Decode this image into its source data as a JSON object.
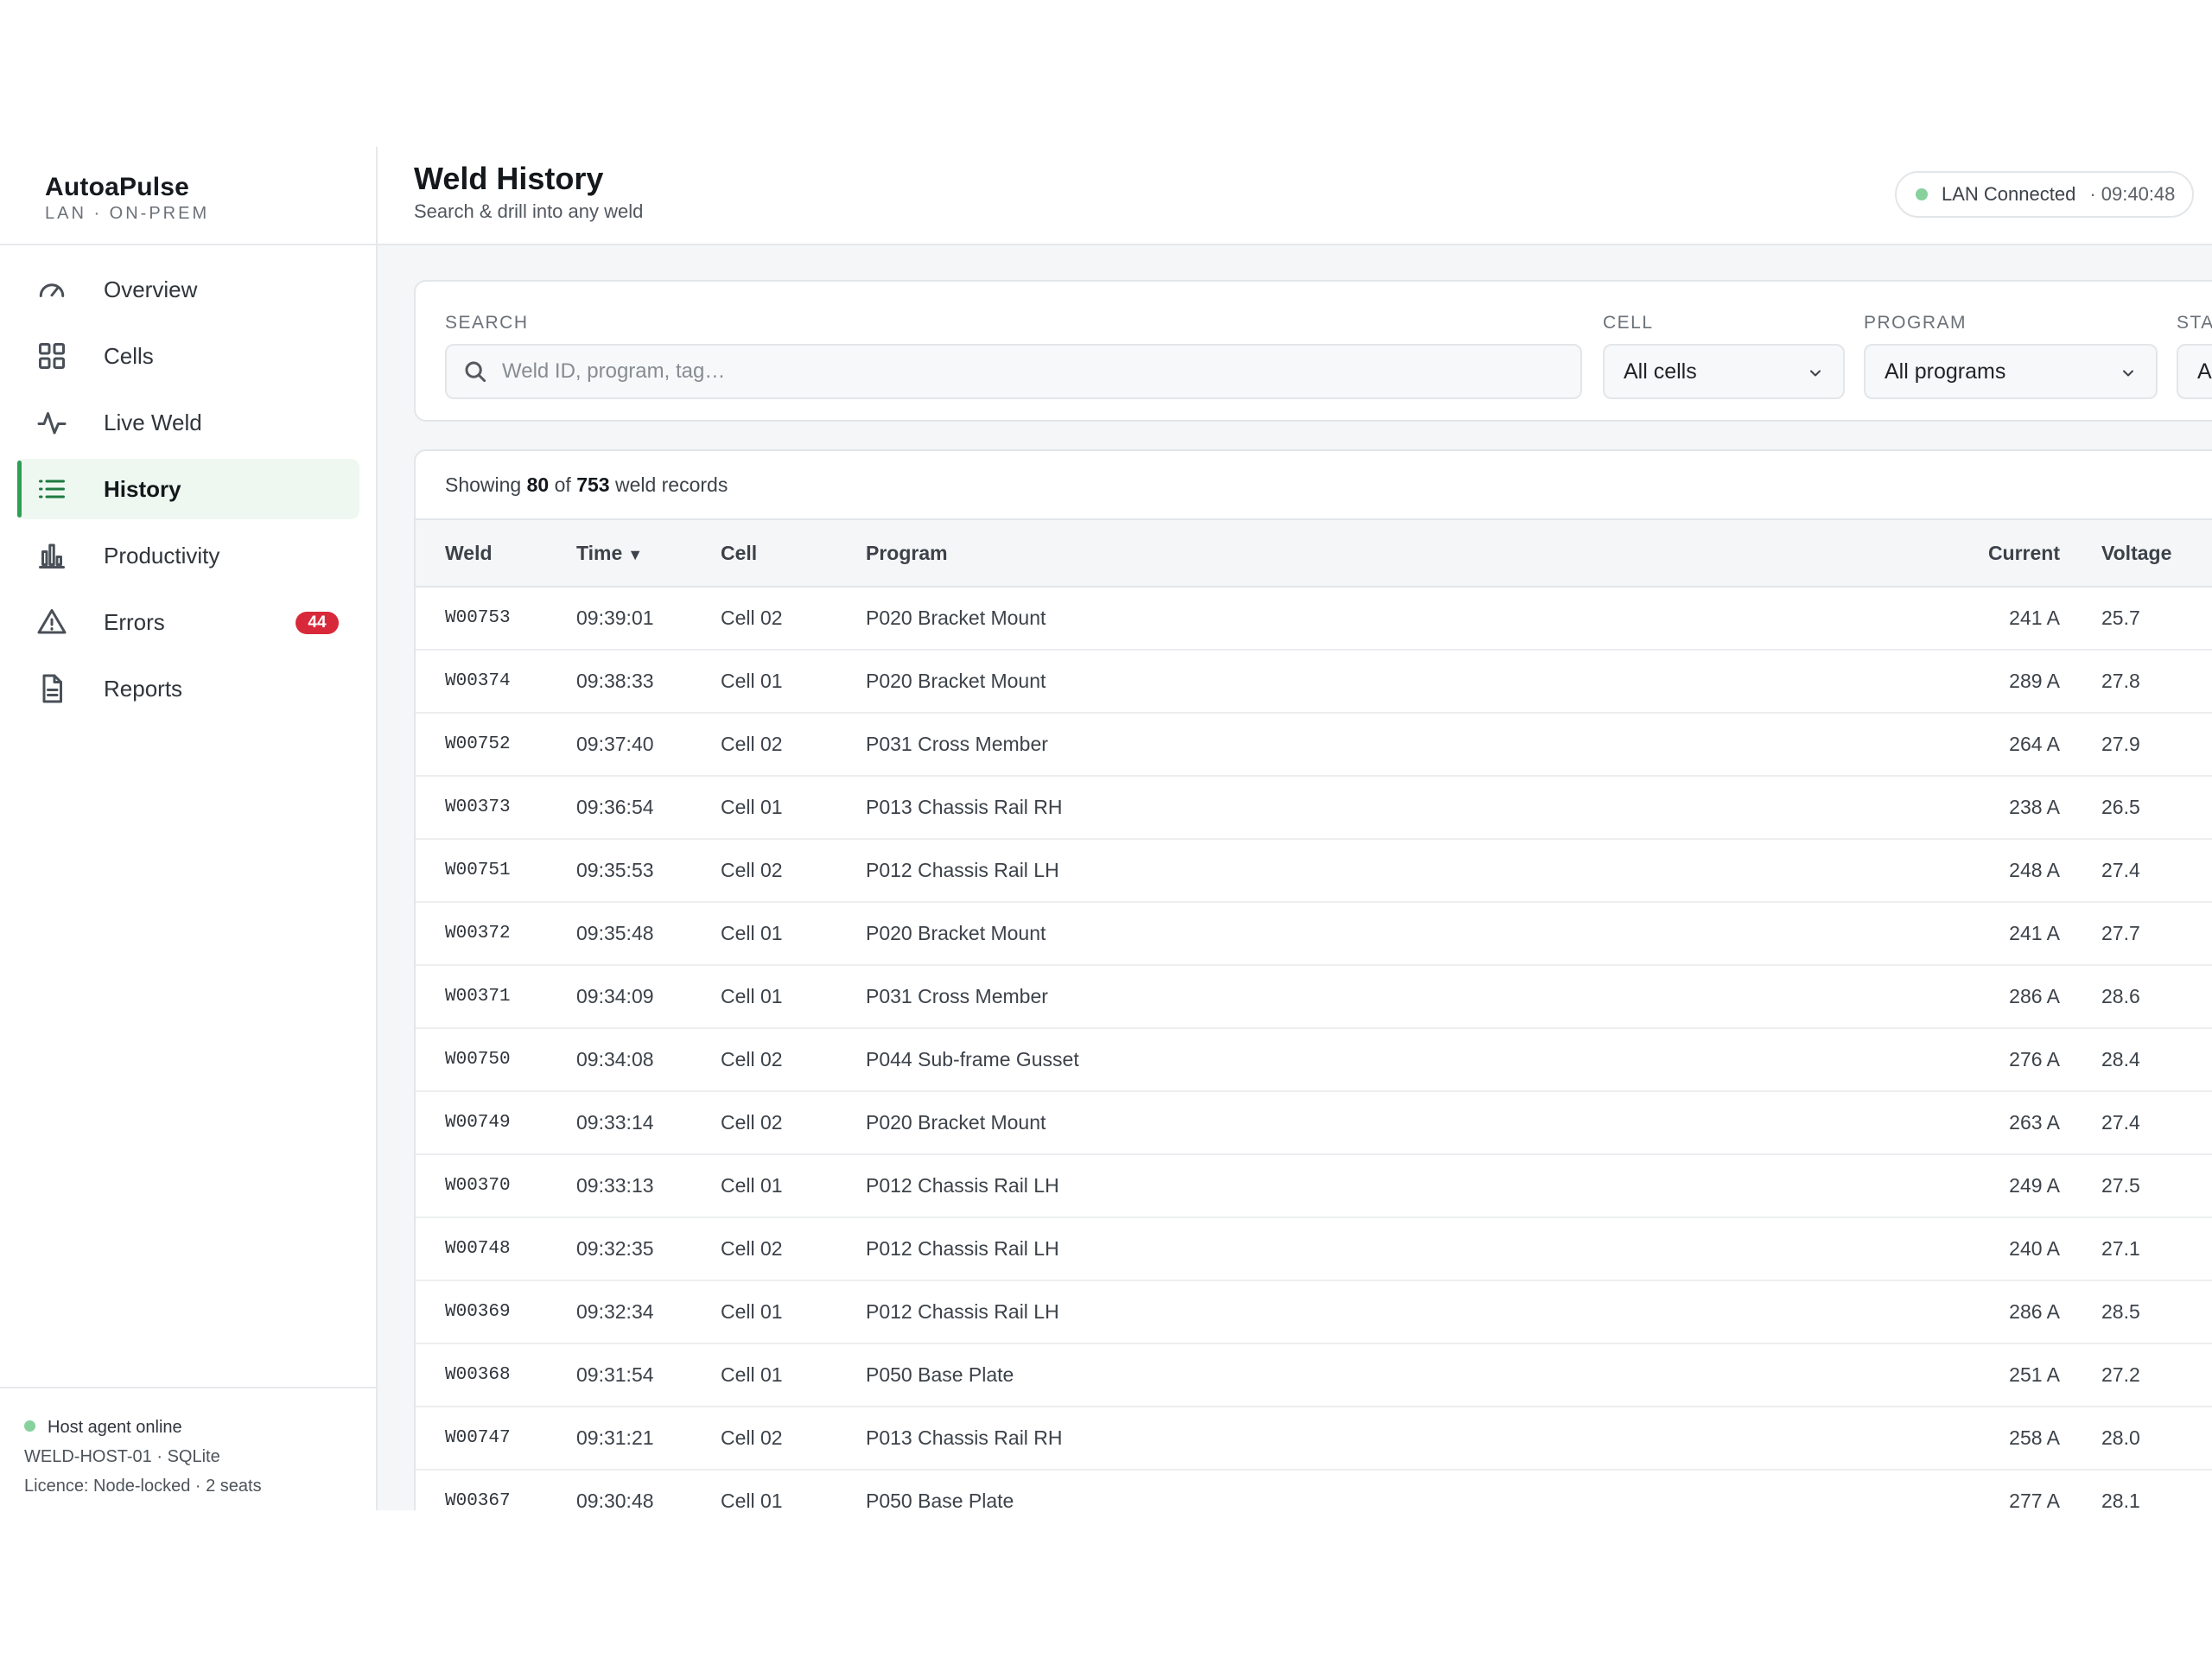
{
  "sidebar": {
    "brand": {
      "name": "AutoaPulse",
      "subtitle": "LAN · ON-PREM"
    },
    "items": [
      {
        "label": "Overview",
        "icon": "gauge-icon",
        "active": false
      },
      {
        "label": "Cells",
        "icon": "grid-icon",
        "active": false
      },
      {
        "label": "Live Weld",
        "icon": "pulse-icon",
        "active": false
      },
      {
        "label": "History",
        "icon": "list-icon",
        "active": true
      },
      {
        "label": "Productivity",
        "icon": "bar-chart-icon",
        "active": false
      },
      {
        "label": "Errors",
        "icon": "warning-icon",
        "active": false,
        "badge": "44"
      },
      {
        "label": "Reports",
        "icon": "document-icon",
        "active": false
      }
    ],
    "footer": {
      "status": "Host agent online",
      "host": "WELD-HOST-01 · SQLite",
      "licence": "Licence: Node-locked · 2 seats"
    }
  },
  "header": {
    "title": "Weld History",
    "subtitle": "Search & drill into any weld",
    "connection": {
      "label": "LAN Connected",
      "time": "· 09:40:48"
    }
  },
  "filters": {
    "search": {
      "label": "SEARCH",
      "placeholder": "Weld ID, program, tag…",
      "value": ""
    },
    "cell": {
      "label": "CELL",
      "value": "All cells"
    },
    "program": {
      "label": "PROGRAM",
      "value": "All programs"
    },
    "status": {
      "label": "STATUS",
      "value": "All"
    }
  },
  "summary": {
    "prefix": "Showing",
    "shown": "80",
    "of": "of",
    "total": "753",
    "suffix": "weld records"
  },
  "table": {
    "columns": {
      "weld": "Weld",
      "time": "Time",
      "sort_indicator": "▼",
      "cell": "Cell",
      "program": "Program",
      "current": "Current",
      "voltage": "Voltage"
    },
    "rows": [
      {
        "weld": "W00753",
        "time": "09:39:01",
        "cell": "Cell 02",
        "program": "P020 Bracket Mount",
        "current": "241 A",
        "voltage": "25.7"
      },
      {
        "weld": "W00374",
        "time": "09:38:33",
        "cell": "Cell 01",
        "program": "P020 Bracket Mount",
        "current": "289 A",
        "voltage": "27.8"
      },
      {
        "weld": "W00752",
        "time": "09:37:40",
        "cell": "Cell 02",
        "program": "P031 Cross Member",
        "current": "264 A",
        "voltage": "27.9"
      },
      {
        "weld": "W00373",
        "time": "09:36:54",
        "cell": "Cell 01",
        "program": "P013 Chassis Rail RH",
        "current": "238 A",
        "voltage": "26.5"
      },
      {
        "weld": "W00751",
        "time": "09:35:53",
        "cell": "Cell 02",
        "program": "P012 Chassis Rail LH",
        "current": "248 A",
        "voltage": "27.4"
      },
      {
        "weld": "W00372",
        "time": "09:35:48",
        "cell": "Cell 01",
        "program": "P020 Bracket Mount",
        "current": "241 A",
        "voltage": "27.7"
      },
      {
        "weld": "W00371",
        "time": "09:34:09",
        "cell": "Cell 01",
        "program": "P031 Cross Member",
        "current": "286 A",
        "voltage": "28.6"
      },
      {
        "weld": "W00750",
        "time": "09:34:08",
        "cell": "Cell 02",
        "program": "P044 Sub-frame Gusset",
        "current": "276 A",
        "voltage": "28.4"
      },
      {
        "weld": "W00749",
        "time": "09:33:14",
        "cell": "Cell 02",
        "program": "P020 Bracket Mount",
        "current": "263 A",
        "voltage": "27.4"
      },
      {
        "weld": "W00370",
        "time": "09:33:13",
        "cell": "Cell 01",
        "program": "P012 Chassis Rail LH",
        "current": "249 A",
        "voltage": "27.5"
      },
      {
        "weld": "W00748",
        "time": "09:32:35",
        "cell": "Cell 02",
        "program": "P012 Chassis Rail LH",
        "current": "240 A",
        "voltage": "27.1"
      },
      {
        "weld": "W00369",
        "time": "09:32:34",
        "cell": "Cell 01",
        "program": "P012 Chassis Rail LH",
        "current": "286 A",
        "voltage": "28.5"
      },
      {
        "weld": "W00368",
        "time": "09:31:54",
        "cell": "Cell 01",
        "program": "P050 Base Plate",
        "current": "251 A",
        "voltage": "27.2"
      },
      {
        "weld": "W00747",
        "time": "09:31:21",
        "cell": "Cell 02",
        "program": "P013 Chassis Rail RH",
        "current": "258 A",
        "voltage": "28.0"
      },
      {
        "weld": "W00367",
        "time": "09:30:48",
        "cell": "Cell 01",
        "program": "P050 Base Plate",
        "current": "277 A",
        "voltage": "28.1"
      }
    ]
  },
  "colors": {
    "accent": "#2f9e56",
    "active_bg": "#eef8f1",
    "badge": "#d8293a",
    "online": "#86d19c"
  }
}
